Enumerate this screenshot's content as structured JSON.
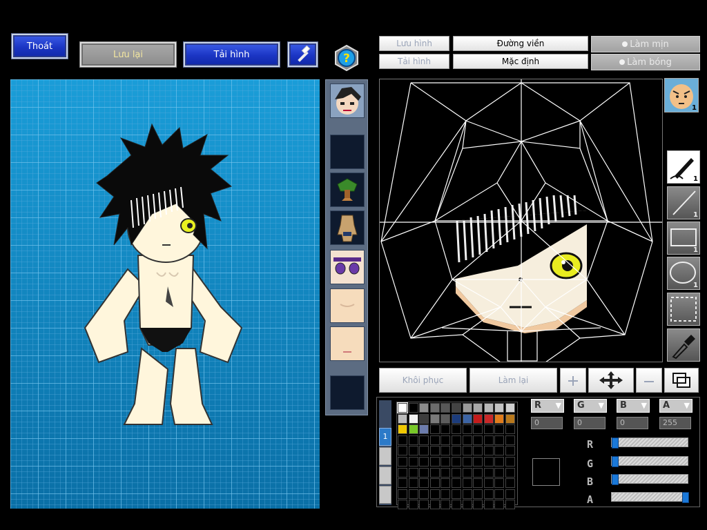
{
  "toolbar": {
    "exit_label": "Thoát",
    "save_label": "Lưu lại",
    "reload_label": "Tải hình"
  },
  "editor": {
    "save_image_label": "Lưu hình",
    "load_image_label": "Tải hình",
    "outline_label": "Đường viền",
    "default_label": "Mặc định",
    "smooth_label": "Làm mịn",
    "shading_label": "Làm bóng",
    "restore_label": "Khôi phục",
    "redo_label": "Làm lại",
    "face_badge": "1"
  },
  "tools": [
    {
      "name": "pen-tool",
      "count": "1"
    },
    {
      "name": "line-tool",
      "count": "1"
    },
    {
      "name": "rectangle-tool",
      "count": "1"
    },
    {
      "name": "ellipse-tool",
      "count": "1"
    },
    {
      "name": "select-tool",
      "count": ""
    },
    {
      "name": "eyedropper-tool",
      "count": ""
    }
  ],
  "palette": {
    "layer_label": "1",
    "colors": [
      "#ffffff",
      "#000000",
      "#8c8c8c",
      "#6c6c6c",
      "#575757",
      "#434343",
      "#9a9a9a",
      "#a8a8a8",
      "#b8b8b8",
      "#c4c4c4",
      "#d0d0d0",
      "#bcbcbc",
      "#f2f2f2",
      "#3c3c3c",
      "#7a7a7a",
      "#5c5c5c",
      "#1c3c7c",
      "#3c64a4",
      "#c41c1c",
      "#c82828",
      "#e07c1c",
      "#b8781c",
      "#f0c800",
      "#78c828",
      "#6c7cac"
    ]
  },
  "channels": {
    "r": {
      "label": "R",
      "value": "0"
    },
    "g": {
      "label": "G",
      "value": "0"
    },
    "b": {
      "label": "B",
      "value": "0"
    },
    "a": {
      "label": "A",
      "value": "255"
    }
  },
  "sliders": {
    "r": 0,
    "g": 0,
    "b": 0,
    "a": 1.0
  }
}
